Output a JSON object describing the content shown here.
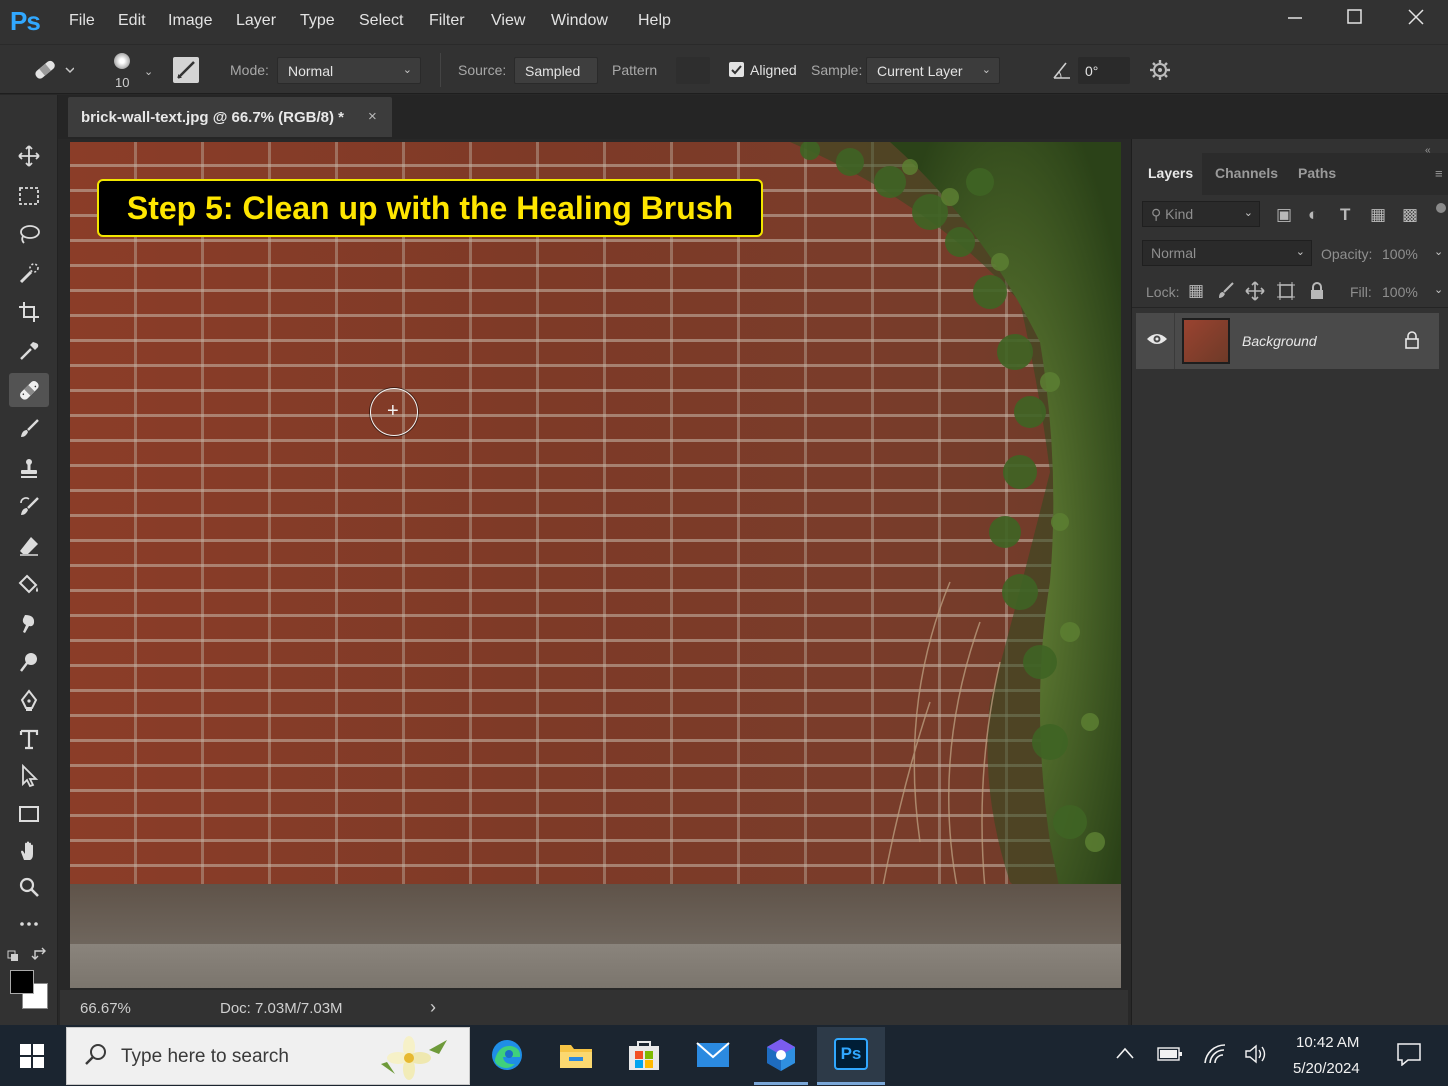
{
  "app": {
    "logo": "Ps",
    "accent_color": "#31a8ff"
  },
  "menu": [
    "File",
    "Edit",
    "Image",
    "Layer",
    "Type",
    "Select",
    "Filter",
    "View",
    "Window",
    "Help"
  ],
  "window_controls": [
    "minimize",
    "maximize",
    "close"
  ],
  "options": {
    "brush_size": "10",
    "mode_label": "Mode:",
    "mode_value": "Normal",
    "source_label": "Source:",
    "source_sampled": "Sampled",
    "source_pattern": "Pattern",
    "aligned_checked": true,
    "aligned_label": "Aligned",
    "sample_label": "Sample:",
    "sample_value": "Current Layer",
    "angle_value": "0°"
  },
  "document": {
    "tab_title": "brick-wall-text.jpg @ 66.7% (RGB/8) *",
    "tab_close": "×",
    "headline": "Step 5: Clean up with the Healing Brush",
    "headline_color": "#ffe600"
  },
  "tools": [
    "move-icon",
    "marquee-icon",
    "lasso-icon",
    "quick-selection-icon",
    "crop-icon",
    "eyedropper-icon",
    "healing-brush-icon",
    "brush-icon",
    "clone-stamp-icon",
    "history-brush-icon",
    "eraser-icon",
    "paint-bucket-icon",
    "smudge-icon",
    "dodge-icon",
    "pen-icon",
    "type-icon",
    "path-selection-icon",
    "rectangle-icon",
    "hand-icon",
    "zoom-icon",
    "more-tools-icon"
  ],
  "active_tool": "healing-brush-icon",
  "status": {
    "zoom": "66.67%",
    "doc": "Doc: 7.03M/7.03M",
    "arrow": "›"
  },
  "layers_panel": {
    "tabs": [
      "Layers",
      "Channels",
      "Paths"
    ],
    "active_tab": "Layers",
    "filter_placeholder": "Kind",
    "blend_mode": "Normal",
    "opacity_label": "Opacity:",
    "opacity_value": "100%",
    "lock_label": "Lock:",
    "fill_label": "Fill:",
    "fill_value": "100%",
    "layers": [
      {
        "name": "Background",
        "visible": true,
        "locked": true
      }
    ]
  },
  "taskbar": {
    "search_placeholder": "Type here to search",
    "apps": [
      "edge-icon",
      "file-explorer-icon",
      "store-icon",
      "mail-icon",
      "app-cube-icon",
      "photoshop-icon"
    ],
    "active_app": "photoshop-icon",
    "time": "10:42 AM",
    "date": "5/20/2024",
    "ps_label": "Ps"
  }
}
